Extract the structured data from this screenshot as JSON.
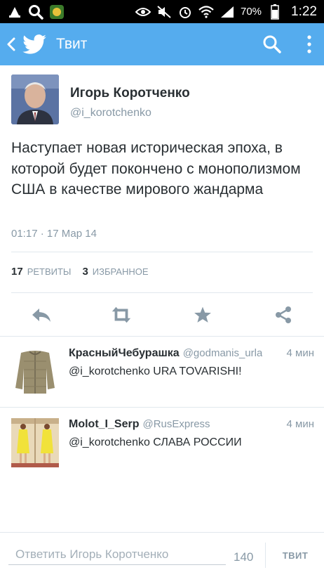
{
  "status_bar": {
    "battery": "70%",
    "time": "1:22"
  },
  "app_bar": {
    "title": "Твит"
  },
  "tweet": {
    "author_name": "Игорь Коротченко",
    "author_handle": "@i_korotchenko",
    "text": "Наступает новая историческая эпоха, в которой будет покончено с монополизмом США в качестве мирового жандарма",
    "timestamp": "01:17 · 17 Мар 14",
    "retweets_count": "17",
    "retweets_label": "РЕТВИТЫ",
    "favorites_count": "3",
    "favorites_label": "ИЗБРАННОЕ"
  },
  "actions": [
    {
      "name": "reply-icon"
    },
    {
      "name": "retweet-icon"
    },
    {
      "name": "favorite-star-icon"
    },
    {
      "name": "share-icon"
    }
  ],
  "replies": [
    {
      "name": "КрасныйЧебурашка",
      "handle": "@godmanis_urla",
      "time": "4 мин",
      "text": "@i_korotchenko URA TOVARISHI!"
    },
    {
      "name": "Molot_I_Serp",
      "handle": "@RusExpress",
      "time": "4 мин",
      "text": "@i_korotchenko СЛАВА РОССИИ"
    }
  ],
  "compose": {
    "placeholder": "Ответить Игорь Коротченко",
    "char_count": "140",
    "send_label": "ТВИТ"
  },
  "colors": {
    "accent": "#55acee",
    "text": "#292f33",
    "muted": "#8899a6"
  }
}
